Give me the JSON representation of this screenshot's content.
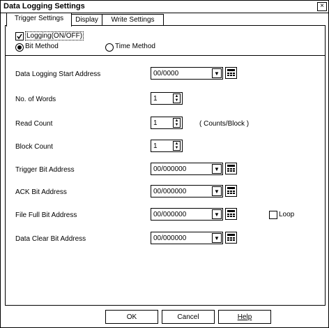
{
  "window": {
    "title": "Data Logging Settings",
    "close_glyph": "×"
  },
  "tabs": [
    {
      "label": "Trigger Settings"
    },
    {
      "label": "Display"
    },
    {
      "label": "Write Settings"
    }
  ],
  "logging": {
    "label": "Logging(ON/OFF)",
    "checked": true
  },
  "method": {
    "bit_label": "Bit Method",
    "time_label": "Time Method",
    "selected": "bit"
  },
  "fields": {
    "start_address": {
      "label": "Data Logging Start Address",
      "value": "00/0000"
    },
    "no_of_words": {
      "label": "No. of Words",
      "value": "1"
    },
    "read_count": {
      "label": "Read Count",
      "value": "1",
      "unit": "( Counts/Block )"
    },
    "block_count": {
      "label": "Block Count",
      "value": "1"
    },
    "trigger_bit": {
      "label": "Trigger Bit Address",
      "value": "00/000000"
    },
    "ack_bit": {
      "label": "ACK Bit Address",
      "value": "00/000000"
    },
    "file_full_bit": {
      "label": "File Full Bit Address",
      "value": "00/000000"
    },
    "data_clear_bit": {
      "label": "Data Clear Bit Address",
      "value": "00/000000"
    }
  },
  "loop": {
    "label": "Loop",
    "checked": false
  },
  "buttons": {
    "ok_label": "OK",
    "cancel_label": "Cancel",
    "help_label": "Help"
  },
  "icons": {
    "dropdown": "chevron-down-icon",
    "keypad": "keypad-icon",
    "spin": "spin-updown-icon"
  }
}
